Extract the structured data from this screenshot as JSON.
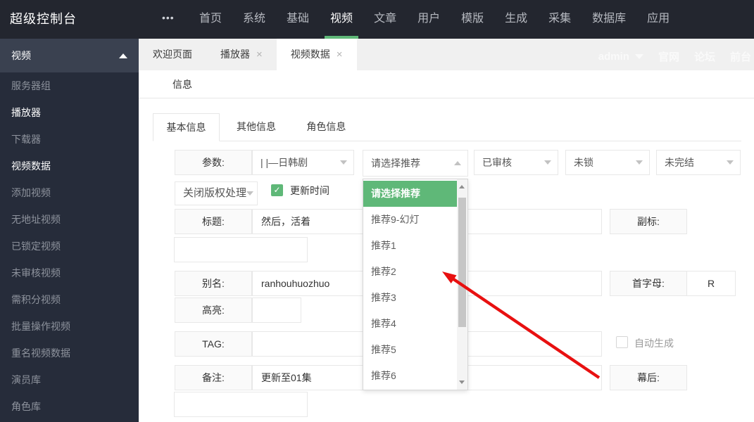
{
  "topnav": {
    "logo": "超级控制台",
    "more_icon": "•••",
    "items": [
      {
        "label": "首页"
      },
      {
        "label": "系统"
      },
      {
        "label": "基础"
      },
      {
        "label": "视频",
        "active": true
      },
      {
        "label": "文章"
      },
      {
        "label": "用户"
      },
      {
        "label": "模版"
      },
      {
        "label": "生成"
      },
      {
        "label": "采集"
      },
      {
        "label": "数据库"
      },
      {
        "label": "应用"
      }
    ]
  },
  "ghost_toolbar": {
    "user": "admin",
    "links": [
      {
        "label": "官网"
      },
      {
        "label": "论坛"
      },
      {
        "label": "前台"
      }
    ]
  },
  "sidebar": {
    "section_label": "视频",
    "items": [
      {
        "label": "服务器组"
      },
      {
        "label": "播放器",
        "highlight": true
      },
      {
        "label": "下载器"
      },
      {
        "label": "视频数据",
        "highlight": true
      },
      {
        "label": "添加视频"
      },
      {
        "label": "无地址视频"
      },
      {
        "label": "已锁定视频"
      },
      {
        "label": "未审核视频"
      },
      {
        "label": "需积分视频"
      },
      {
        "label": "批量操作视频"
      },
      {
        "label": "重名视频数据"
      },
      {
        "label": "演员库"
      },
      {
        "label": "角色库"
      }
    ]
  },
  "tabbar": {
    "close_icon": "×",
    "tabs": [
      {
        "label": "欢迎页面",
        "closable": false
      },
      {
        "label": "播放器",
        "closable": true
      },
      {
        "label": "视频数据",
        "closable": true,
        "active": true
      }
    ]
  },
  "breadcrumb": {
    "label": "信息"
  },
  "form_tabs": [
    {
      "label": "基本信息",
      "active": true
    },
    {
      "label": "其他信息"
    },
    {
      "label": "角色信息"
    }
  ],
  "form": {
    "param_label": "参数:",
    "param_value": "| |—日韩剧",
    "recommend_value": "请选择推荐",
    "audit_value": "已审核",
    "lock_value": "未锁",
    "finish_value": "未完结",
    "copyright_value": "关闭版权处理",
    "update_time_label": "更新时间",
    "update_time_checked": true,
    "check_icon": "✓",
    "title_label": "标题:",
    "title_value": "然后，活着",
    "subtitle_label": "副标:",
    "alias_label": "别名:",
    "alias_value": "ranhouhuozhuo",
    "initial_label": "首字母:",
    "initial_value": "R",
    "highlight_label": "高亮:",
    "tag_label": "TAG:",
    "auto_generate_label": "自动生成",
    "auto_generate_checked": false,
    "note_label": "备注:",
    "note_value": "更新至01集",
    "behind_label": "幕后:"
  },
  "recommend_dropdown": {
    "options": [
      {
        "label": "请选择推荐",
        "selected": true
      },
      {
        "label": "推荐9-幻灯"
      },
      {
        "label": "推荐1"
      },
      {
        "label": "推荐2"
      },
      {
        "label": "推荐3"
      },
      {
        "label": "推荐4"
      },
      {
        "label": "推荐5"
      },
      {
        "label": "推荐6"
      }
    ]
  },
  "colors": {
    "accent_green": "#5FB878",
    "arrow_red": "#e81010",
    "nav_bg": "#23262f",
    "sidebar_bg": "#262c3a"
  }
}
